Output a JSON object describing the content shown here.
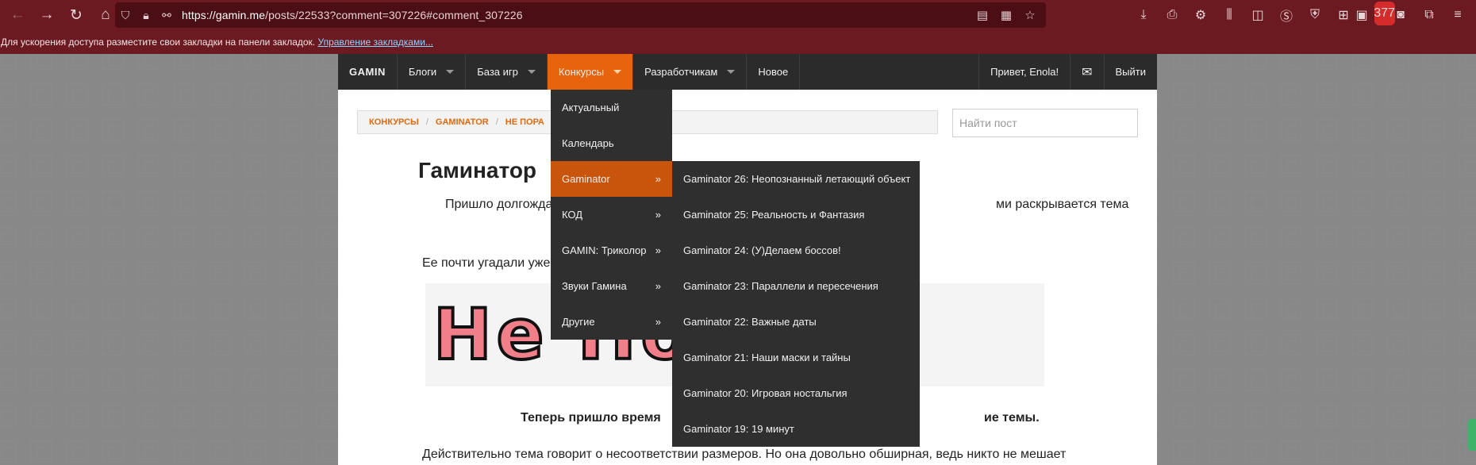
{
  "browser": {
    "url_host": "https://gamin.me",
    "url_path": "/posts/22533?comment=307226#comment_307226",
    "notification_count": "377",
    "bookmarks_text": "Для ускорения доступа разместите свои закладки на панели закладок.",
    "bookmarks_link": "Управление закладками..."
  },
  "sitenav": {
    "logo": "GAMIN",
    "items": [
      "Блоги",
      "База игр",
      "Конкурсы",
      "Разработчикам",
      "Новое"
    ],
    "greeting": "Привет, Enola!",
    "logout": "Выйти"
  },
  "breadcrumb": [
    "КОНКУРСЫ",
    "GAMINATOR",
    "НЕ ПОРА"
  ],
  "search": {
    "placeholder": "Найти пост"
  },
  "post": {
    "title": "Гаминатор",
    "line1_left": "Пришло долгожда",
    "line1_right": "ми раскрывается тема",
    "line2": "Ее почти угадали уже",
    "banner_text": "Не По        рУ!",
    "line3_left": "Теперь пришло время",
    "line3_right": "ие темы.",
    "line4": "Действительно тема говорит о несоответствии размеров. Но она довольно обширная, ведь никто не мешает"
  },
  "dropdown1": {
    "items": [
      {
        "label": "Актуальный",
        "arrow": ""
      },
      {
        "label": "Календарь",
        "arrow": ""
      },
      {
        "label": "Gaminator",
        "arrow": "»"
      },
      {
        "label": "КОД",
        "arrow": "»"
      },
      {
        "label": "GAMIN: Триколор",
        "arrow": "»"
      },
      {
        "label": "Звуки Гамина",
        "arrow": "»"
      },
      {
        "label": "Другие",
        "arrow": "»"
      }
    ]
  },
  "dropdown2": {
    "items": [
      "Gaminator 26: Неопознанный летающий объект",
      "Gaminator 25: Реальность и Фантазия",
      "Gaminator 24: (У)Делаем боссов!",
      "Gaminator 23: Параллели и пересечения",
      "Gaminator 22: Важные даты",
      "Gaminator 21: Наши маски и тайны",
      "Gaminator 20: Игровая ностальгия",
      "Gaminator 19: 19 минут"
    ]
  }
}
